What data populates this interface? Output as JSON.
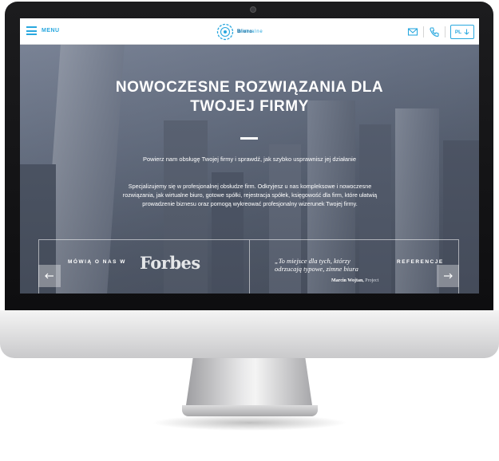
{
  "header": {
    "menu_label": "MENU",
    "logo_line1": "Wirtualne",
    "logo_line2": "Biuro",
    "lang_label": "PL"
  },
  "hero": {
    "title": "NOWOCZESNE ROZWIĄZANIA DLA TWOJEJ FIRMY",
    "subtitle": "Powierz nam obsługę Twojej firmy i sprawdź, jak szybko usprawnisz jej działanie",
    "body": "Specjalizujemy się w profesjonalnej obsłudze firm. Odkryjesz u nas kompleksowe i nowoczesne rozwiązania, jak wirtualne biuro, gotowe spółki, rejestracja spółek, księgowość dla firm, które ułatwią prowadzenie biznesu oraz pomogą wykreować profesjonalny wizerunek Twojej firmy."
  },
  "press": {
    "label": "MÓWIĄ O NAS W",
    "logo_text": "Forbes"
  },
  "testimonial": {
    "quote": "„To miejsce dla tych, którzy odrzucają typowe, zimne biura",
    "author": "Marcin Wojtan,",
    "company": "Project",
    "label": "REFERENCJE"
  },
  "colors": {
    "accent": "#29a8df",
    "accent_dark": "#1f6fa0",
    "hero_text": "#ffffff"
  },
  "icons": [
    "menu-icon",
    "logo-icon",
    "mail-icon",
    "phone-icon",
    "arrow-down-icon",
    "arrow-left-icon",
    "arrow-right-icon"
  ]
}
